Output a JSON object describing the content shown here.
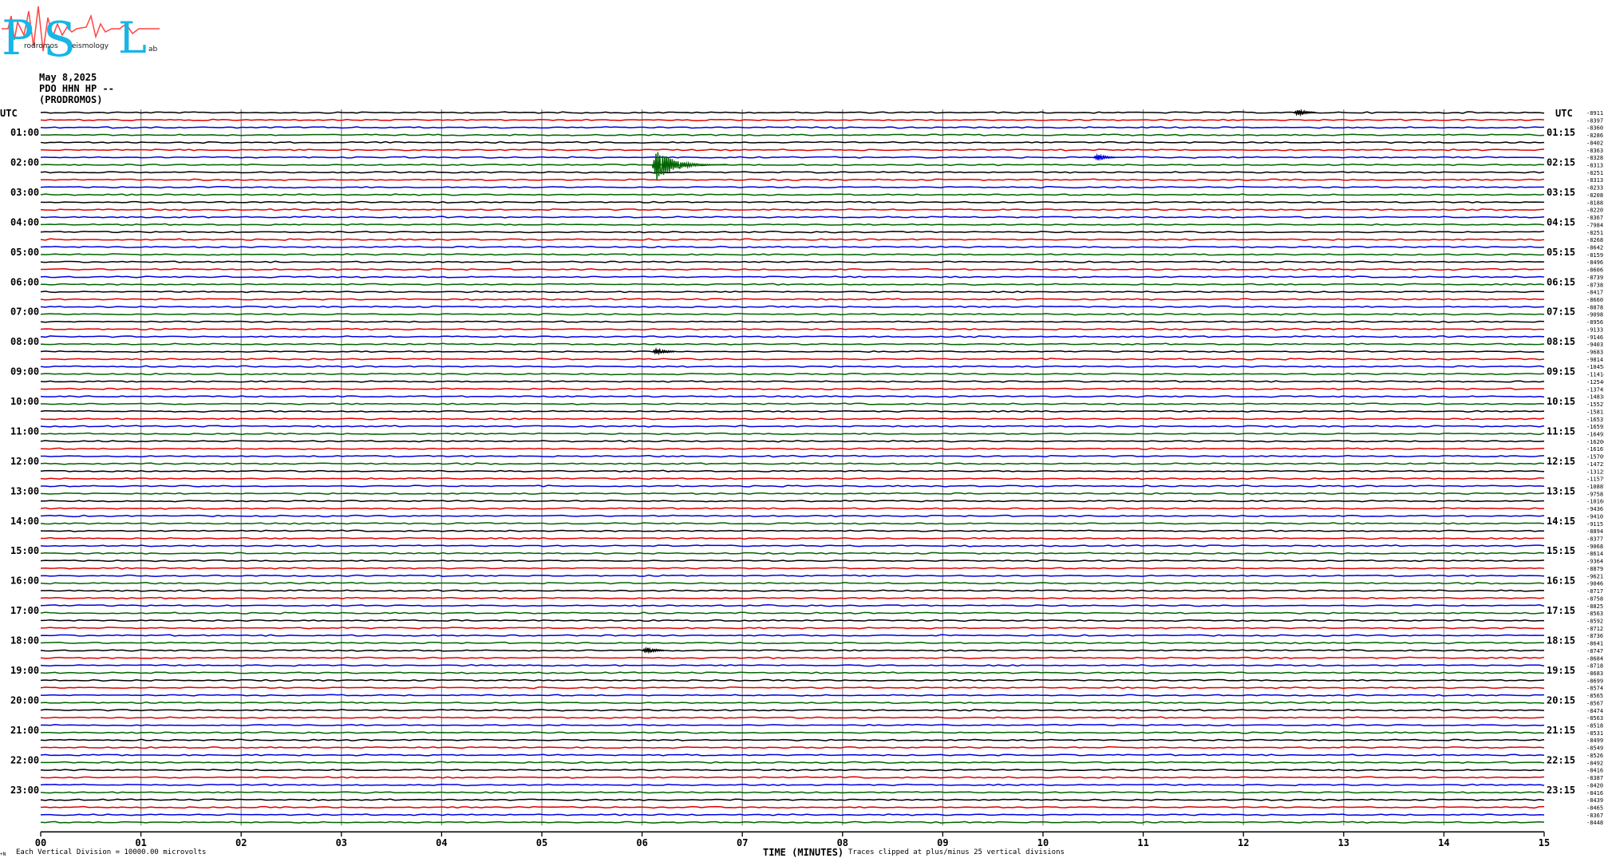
{
  "logo": {
    "letters": [
      "P",
      "S",
      "L"
    ],
    "small_words": [
      "rodromos",
      "eismology",
      "ab"
    ]
  },
  "header": {
    "date": "May 8,2025",
    "station": "PDO HHN HP --",
    "location": "(PRODROMOS)"
  },
  "chart_data": {
    "type": "line",
    "title": "May 8,2025",
    "xlabel": "TIME (MINUTES)",
    "left_axis_label": "UTC",
    "right_axis_label": "UTC",
    "xlim": [
      0,
      15
    ],
    "x_ticks": [
      "00",
      "01",
      "02",
      "03",
      "04",
      "05",
      "06",
      "07",
      "08",
      "09",
      "10",
      "11",
      "12",
      "13",
      "14",
      "15"
    ],
    "left_time_labels": [
      "01:00",
      "02:00",
      "03:00",
      "04:00",
      "05:00",
      "06:00",
      "07:00",
      "08:00",
      "09:00",
      "10:00",
      "11:00",
      "12:00",
      "13:00",
      "14:00",
      "15:00",
      "16:00",
      "17:00",
      "18:00",
      "19:00",
      "20:00",
      "21:00",
      "22:00",
      "23:00"
    ],
    "right_time_labels": [
      "01:15",
      "02:15",
      "03:15",
      "04:15",
      "05:15",
      "06:15",
      "07:15",
      "08:15",
      "09:15",
      "10:15",
      "11:15",
      "12:15",
      "13:15",
      "14:15",
      "15:15",
      "16:15",
      "17:15",
      "18:15",
      "19:15",
      "20:15",
      "21:15",
      "22:15",
      "23:15"
    ],
    "trace_colors": [
      "#000000",
      "#e00000",
      "#0000e0",
      "#006400"
    ],
    "row_offsets": [
      "-8911",
      "-8397",
      "-8360",
      "-8286",
      "-8402",
      "-8363",
      "-8328",
      "-8313",
      "-8251",
      "-8313",
      "-8233",
      "-8208",
      "-8188",
      "-8220",
      "-8367",
      "-7984",
      "-8251",
      "-8268",
      "-8642",
      "-8159",
      "-8496",
      "-8606",
      "-8739",
      "-8738",
      "-8417",
      "-8660",
      "-8878",
      "-9098",
      "-8956",
      "-9133",
      "-9146",
      "-9403",
      "-9683",
      "-9814",
      "-10458",
      "-11414",
      "-12546",
      "-13745",
      "-14838",
      "-15527",
      "-15813",
      "-16537",
      "-16592",
      "-16492",
      "-16206",
      "-16167",
      "-15709",
      "-14725",
      "-13125",
      "-11579",
      "-10887",
      "-9758",
      "-10160",
      "-9436",
      "-9410",
      "-9115",
      "-8894",
      "-8377",
      "-9068",
      "-8614",
      "-9364",
      "-8879",
      "-9621",
      "-9046",
      "-8717",
      "-8758",
      "-8825",
      "-8563",
      "-8592",
      "-8712",
      "-8736",
      "-8641",
      "-8747",
      "-8684",
      "-8718",
      "-8683",
      "-8699",
      "-8574",
      "-8565",
      "-8567",
      "-8474",
      "-8563",
      "-8518",
      "-8531",
      "-8499",
      "-8549",
      "-8526",
      "-8492",
      "-8416",
      "-8387",
      "-8420",
      "-8416",
      "-8439",
      "-8465",
      "-8367",
      "-8448"
    ],
    "events": [
      {
        "row": 7,
        "minute": 6.1,
        "note": "earthquake"
      },
      {
        "row": 0,
        "minute": 12.5
      },
      {
        "row": 6,
        "minute": 10.5
      },
      {
        "row": 32,
        "minute": 6.1
      },
      {
        "row": 72,
        "minute": 6.0
      }
    ],
    "grid": true
  },
  "footer": {
    "scale": "Each Vertical Division = 10000.00 microvolts",
    "clip": "Traces clipped at plus/minus 25 vertical divisions",
    "mark": "+N"
  }
}
